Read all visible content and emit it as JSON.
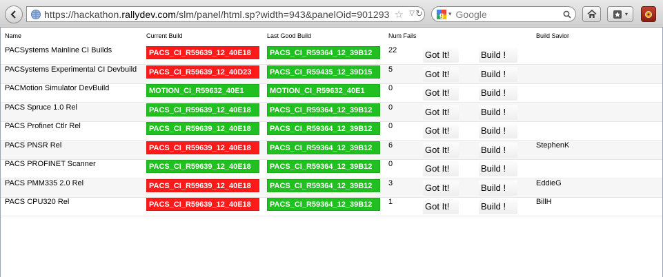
{
  "browser": {
    "url_prefix": "https://hackathon.",
    "url_domain": "rallydev.com",
    "url_suffix": "/slm/panel/html.sp?width=943&panelOid=901293",
    "search_placeholder": "Google"
  },
  "headers": {
    "name": "Name",
    "current": "Current Build",
    "last": "Last Good Build",
    "fails": "Num Fails",
    "savior": "Build Savior"
  },
  "colors": {
    "fail": "#ff1a1a",
    "pass": "#1fc01f"
  },
  "rows": [
    {
      "name": "PACSystems Mainline CI Builds",
      "current": "PACS_CI_R59639_12_40E18",
      "current_status": "fail",
      "last": "PACS_CI_R59364_12_39B12",
      "last_status": "pass",
      "fails": "22",
      "gotit": "Got It!",
      "build": "Build !",
      "savior": ""
    },
    {
      "name": "PACSystems Experimental CI Devbuild",
      "current": "PACS_CI_R59639_12_40D23",
      "current_status": "fail",
      "last": "PACS_CI_R59435_12_39D15",
      "last_status": "pass",
      "fails": "5",
      "gotit": "Got It!",
      "build": "Build !",
      "savior": ""
    },
    {
      "name": "PACMotion Simulator DevBuild",
      "current": "MOTION_CI_R59632_40E1",
      "current_status": "pass",
      "last": "MOTION_CI_R59632_40E1",
      "last_status": "pass",
      "fails": "0",
      "gotit": "Got It!",
      "build": "Build !",
      "savior": ""
    },
    {
      "name": "PACS Spruce 1.0 Rel",
      "current": "PACS_CI_R59639_12_40E18",
      "current_status": "pass",
      "last": "PACS_CI_R59364_12_39B12",
      "last_status": "pass",
      "fails": "0",
      "gotit": "Got It!",
      "build": "Build !",
      "savior": ""
    },
    {
      "name": "PACS Profinet Ctlr Rel",
      "current": "PACS_CI_R59639_12_40E18",
      "current_status": "pass",
      "last": "PACS_CI_R59364_12_39B12",
      "last_status": "pass",
      "fails": "0",
      "gotit": "Got It!",
      "build": "Build !",
      "savior": ""
    },
    {
      "name": "PACS PNSR Rel",
      "current": "PACS_CI_R59639_12_40E18",
      "current_status": "fail",
      "last": "PACS_CI_R59364_12_39B12",
      "last_status": "pass",
      "fails": "6",
      "gotit": "Got It!",
      "build": "Build !",
      "savior": "StephenK"
    },
    {
      "name": "PACS PROFINET Scanner",
      "current": "PACS_CI_R59639_12_40E18",
      "current_status": "pass",
      "last": "PACS_CI_R59364_12_39B12",
      "last_status": "pass",
      "fails": "0",
      "gotit": "Got It!",
      "build": "Build !",
      "savior": ""
    },
    {
      "name": "PACS PMM335 2.0 Rel",
      "current": "PACS_CI_R59639_12_40E18",
      "current_status": "fail",
      "last": "PACS_CI_R59364_12_39B12",
      "last_status": "pass",
      "fails": "3",
      "gotit": "Got It!",
      "build": "Build !",
      "savior": "EddieG"
    },
    {
      "name": "PACS CPU320 Rel",
      "current": "PACS_CI_R59639_12_40E18",
      "current_status": "fail",
      "last": "PACS_CI_R59364_12_39B12",
      "last_status": "pass",
      "fails": "1",
      "gotit": "Got It!",
      "build": "Build !",
      "savior": "BillH"
    }
  ]
}
